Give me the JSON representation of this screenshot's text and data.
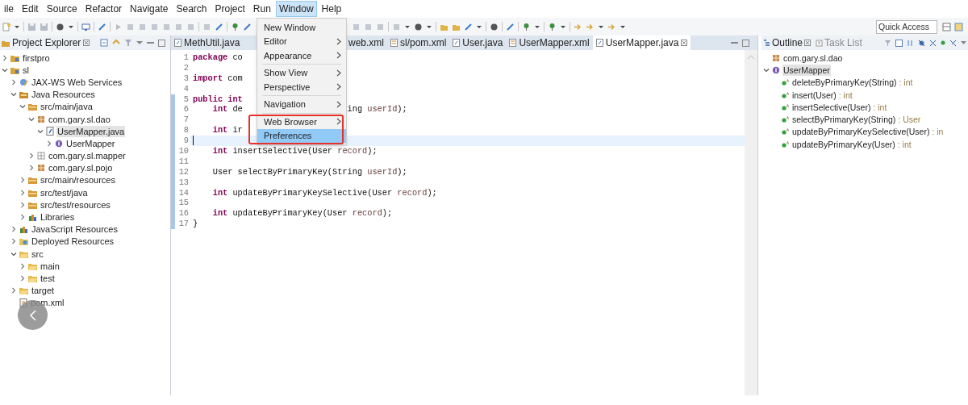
{
  "menu_bar": [
    {
      "label": "ile",
      "selected": false
    },
    {
      "label": "Edit",
      "selected": false
    },
    {
      "label": "Source",
      "selected": false
    },
    {
      "label": "Refactor",
      "selected": false
    },
    {
      "label": "Navigate",
      "selected": false
    },
    {
      "label": "Search",
      "selected": false
    },
    {
      "label": "Project",
      "selected": false
    },
    {
      "label": "Run",
      "selected": false
    },
    {
      "label": "Window",
      "selected": true
    },
    {
      "label": "Help",
      "selected": false
    }
  ],
  "toolbar": {
    "quick_access": {
      "placeholder": "Quick Access"
    }
  },
  "project_explorer": {
    "title": "Project Explorer",
    "tree": [
      {
        "label": "firstpro",
        "kind": "project",
        "expanded": false,
        "selected": false
      },
      {
        "label": "sl",
        "kind": "project",
        "expanded": true,
        "selected": false,
        "children": [
          {
            "label": "JAX-WS Web Services",
            "kind": "web-services",
            "expanded": false,
            "selected": false
          },
          {
            "label": "Java Resources",
            "kind": "java-resources",
            "expanded": true,
            "selected": false,
            "children": [
              {
                "label": "src/main/java",
                "kind": "source-folder",
                "expanded": true,
                "selected": false,
                "children": [
                  {
                    "label": "com.gary.sl.dao",
                    "kind": "package",
                    "expanded": true,
                    "selected": false,
                    "children": [
                      {
                        "label": "UserMapper.java",
                        "kind": "java-file",
                        "expanded": true,
                        "selected": true,
                        "children": [
                          {
                            "label": "UserMapper",
                            "kind": "interface",
                            "expanded": false,
                            "selected": false
                          }
                        ]
                      }
                    ]
                  },
                  {
                    "label": "com.gary.sl.mapper",
                    "kind": "empty-package",
                    "expanded": false,
                    "selected": false
                  },
                  {
                    "label": "com.gary.sl.pojo",
                    "kind": "package",
                    "expanded": false,
                    "selected": false
                  }
                ]
              },
              {
                "label": "src/main/resources",
                "kind": "source-folder",
                "expanded": false,
                "selected": false
              },
              {
                "label": "src/test/java",
                "kind": "source-folder",
                "expanded": false,
                "selected": false
              },
              {
                "label": "src/test/resources",
                "kind": "source-folder",
                "expanded": false,
                "selected": false
              },
              {
                "label": "Libraries",
                "kind": "library",
                "expanded": false,
                "selected": false
              }
            ]
          },
          {
            "label": "JavaScript Resources",
            "kind": "library",
            "expanded": false,
            "selected": false
          },
          {
            "label": "Deployed Resources",
            "kind": "deployed",
            "expanded": false,
            "selected": false
          },
          {
            "label": "src",
            "kind": "folder",
            "expanded": true,
            "selected": false,
            "children": [
              {
                "label": "main",
                "kind": "folder",
                "expanded": false,
                "selected": false
              },
              {
                "label": "test",
                "kind": "folder",
                "expanded": false,
                "selected": false
              }
            ]
          },
          {
            "label": "target",
            "kind": "folder",
            "expanded": false,
            "selected": false
          },
          {
            "label": "pom.xml",
            "kind": "xml-file",
            "selected": false
          }
        ]
      }
    ]
  },
  "editor": {
    "tabs": [
      {
        "label": "MethUtil.java",
        "kind": "java",
        "selected": false
      },
      {
        "label": "web.xml",
        "selected": false
      },
      {
        "label": "sl/pom.xml",
        "kind": "xml",
        "selected": false
      },
      {
        "label": "User.java",
        "kind": "java",
        "selected": false
      },
      {
        "label": "UserMapper.xml",
        "kind": "xml",
        "selected": false
      },
      {
        "label": "UserMapper.java",
        "kind": "java",
        "selected": true
      }
    ],
    "lines": [
      {
        "number": "1",
        "current": false,
        "changed": false,
        "indented": false,
        "segments": [
          {
            "kind": "keyword",
            "text": "package"
          },
          {
            "kind": "plain",
            "text": " co"
          }
        ]
      },
      {
        "number": "2",
        "current": false,
        "changed": false
      },
      {
        "number": "3",
        "current": false,
        "changed": false,
        "indented": false,
        "segments": [
          {
            "kind": "keyword",
            "text": "import"
          },
          {
            "kind": "plain",
            "text": " com"
          }
        ]
      },
      {
        "number": "4",
        "current": false,
        "changed": false
      },
      {
        "number": "5",
        "current": false,
        "changed": true,
        "indented": false,
        "segments": [
          {
            "kind": "keyword",
            "text": "public int"
          }
        ]
      },
      {
        "number": "6",
        "current": false,
        "changed": true,
        "indented": true,
        "segments": [
          {
            "kind": "keyword",
            "text": "int"
          },
          {
            "kind": "plain",
            "text": " de"
          }
        ],
        "tail": [
          {
            "kind": "plain",
            "text": "ing "
          },
          {
            "kind": "param",
            "text": "userId"
          },
          {
            "kind": "plain",
            "text": ");"
          }
        ]
      },
      {
        "number": "7",
        "current": false,
        "changed": true
      },
      {
        "number": "8",
        "current": false,
        "changed": true,
        "indented": true,
        "segments": [
          {
            "kind": "keyword",
            "text": "int"
          },
          {
            "kind": "plain",
            "text": " ir"
          }
        ]
      },
      {
        "number": "9",
        "current": true,
        "changed": true
      },
      {
        "number": "10",
        "current": false,
        "changed": true,
        "indented": true,
        "segments": [
          {
            "kind": "keyword",
            "text": "int"
          },
          {
            "kind": "plain",
            "text": " insertSelective(User "
          },
          {
            "kind": "param",
            "text": "record"
          },
          {
            "kind": "plain",
            "text": ");"
          }
        ]
      },
      {
        "number": "11",
        "current": false,
        "changed": true
      },
      {
        "number": "12",
        "current": false,
        "changed": true,
        "indented": true,
        "segments": [
          {
            "kind": "plain",
            "text": "User selectByPrimaryKey(String "
          },
          {
            "kind": "param",
            "text": "userId"
          },
          {
            "kind": "plain",
            "text": ");"
          }
        ]
      },
      {
        "number": "13",
        "current": false,
        "changed": true
      },
      {
        "number": "14",
        "current": false,
        "changed": true,
        "indented": true,
        "segments": [
          {
            "kind": "keyword",
            "text": "int"
          },
          {
            "kind": "plain",
            "text": " updateByPrimaryKeySelective(User "
          },
          {
            "kind": "param",
            "text": "record"
          },
          {
            "kind": "plain",
            "text": ");"
          }
        ]
      },
      {
        "number": "15",
        "current": false,
        "changed": true
      },
      {
        "number": "16",
        "current": false,
        "changed": true,
        "indented": true,
        "segments": [
          {
            "kind": "keyword",
            "text": "int"
          },
          {
            "kind": "plain",
            "text": " updateByPrimaryKey(User "
          },
          {
            "kind": "param",
            "text": "record"
          },
          {
            "kind": "plain",
            "text": ");"
          }
        ]
      },
      {
        "number": "17",
        "current": false,
        "changed": true,
        "indented": false,
        "segments": [
          {
            "kind": "plain",
            "text": "}"
          }
        ]
      }
    ]
  },
  "window_menu": {
    "groups": [
      [
        {
          "label": "New Window",
          "submenu": false,
          "selected": false
        },
        {
          "label": "Editor",
          "submenu": true,
          "selected": false
        },
        {
          "label": "Appearance",
          "submenu": true,
          "selected": false
        }
      ],
      [
        {
          "label": "Show View",
          "submenu": true,
          "selected": false
        },
        {
          "label": "Perspective",
          "submenu": true,
          "selected": false
        }
      ],
      [
        {
          "label": "Navigation",
          "submenu": true,
          "selected": false
        }
      ],
      [
        {
          "label": "Web Browser",
          "submenu": true,
          "selected": false
        },
        {
          "label": "Preferences",
          "submenu": false,
          "selected": true
        }
      ]
    ]
  },
  "outline": {
    "tabs": [
      {
        "label": "Outline",
        "selected": true
      },
      {
        "label": "Task List",
        "selected": false
      }
    ],
    "tree": [
      {
        "label": "com.gary.sl.dao",
        "kind": "package",
        "selected": false
      },
      {
        "label": "UserMapper",
        "kind": "interface",
        "expanded": true,
        "selected": true,
        "children": [
          {
            "label": "deleteByPrimaryKey(String)",
            "type": " : int",
            "kind": "method",
            "selected": false
          },
          {
            "label": "insert(User)",
            "type": " : int",
            "kind": "method",
            "selected": false
          },
          {
            "label": "insertSelective(User)",
            "type": " : int",
            "kind": "method",
            "selected": false
          },
          {
            "label": "selectByPrimaryKey(String)",
            "type": " : User",
            "kind": "method",
            "selected": false
          },
          {
            "label": "updateByPrimaryKeySelective(User)",
            "type": " : in",
            "kind": "method",
            "selected": false
          },
          {
            "label": "updateByPrimaryKey(User)",
            "type": " : int",
            "kind": "method",
            "selected": false
          }
        ]
      }
    ]
  }
}
